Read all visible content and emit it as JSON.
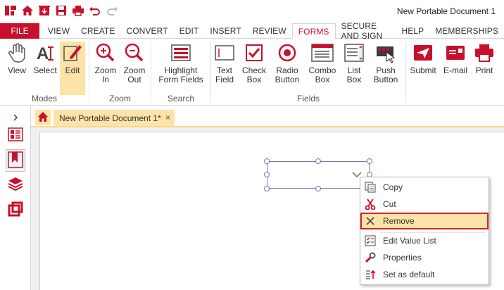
{
  "window": {
    "title": "New Portable Document 1"
  },
  "quick_access": [
    "app-logo-icon",
    "home-icon",
    "download-icon",
    "save-icon",
    "print-icon",
    "undo-icon",
    "redo-icon"
  ],
  "menu": {
    "file": "FILE",
    "tabs": [
      "VIEW",
      "CREATE",
      "CONVERT",
      "EDIT",
      "INSERT",
      "REVIEW",
      "FORMS",
      "SECURE AND SIGN",
      "HELP",
      "MEMBERSHIPS"
    ],
    "active_tab": "FORMS"
  },
  "ribbon": {
    "modes": {
      "label": "Modes",
      "view": "View",
      "select": "Select",
      "edit": "Edit"
    },
    "zoom": {
      "label": "Zoom",
      "zoom_in_1": "Zoom",
      "zoom_in_2": "In",
      "zoom_out_1": "Zoom",
      "zoom_out_2": "Out"
    },
    "search": {
      "label": "Search",
      "highlight_1": "Highlight",
      "highlight_2": "Form Fields"
    },
    "fields": {
      "label": "Fields",
      "text_1": "Text",
      "text_2": "Field",
      "check_1": "Check",
      "check_2": "Box",
      "radio_1": "Radio",
      "radio_2": "Button",
      "combo_1": "Combo",
      "combo_2": "Box",
      "list_1": "List",
      "list_2": "Box",
      "push_1": "Push",
      "push_2": "Button"
    },
    "actions": {
      "submit": "Submit",
      "email": "E-mail",
      "print": "Print"
    }
  },
  "document_tab": {
    "name": "New Portable Document 1*",
    "close": "×"
  },
  "context_menu": {
    "copy": "Copy",
    "cut": "Cut",
    "remove": "Remove",
    "edit_value_list": "Edit Value List",
    "properties": "Properties",
    "set_as_default": "Set as default"
  },
  "colors": {
    "brand": "#c8102e",
    "highlight": "#fde3a7",
    "field_border": "#8a6db0"
  }
}
